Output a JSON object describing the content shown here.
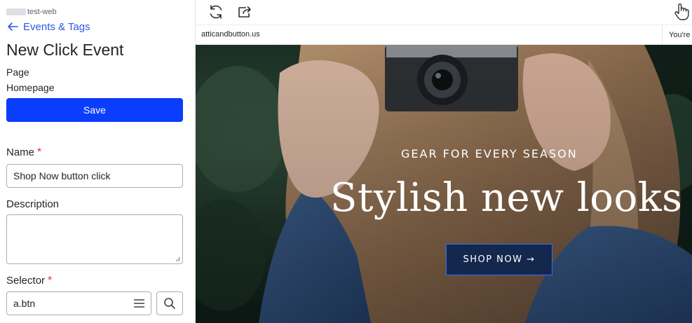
{
  "sidebar": {
    "project_name": "test-web",
    "back_link": "Events & Tags",
    "title": "New Click Event",
    "page_label": "Page",
    "page_value": "Homepage",
    "save_label": "Save",
    "name_label": "Name",
    "name_value": "Shop Now button click",
    "description_label": "Description",
    "selector_label": "Selector",
    "selector_value": "a.btn",
    "required_mark": "*"
  },
  "preview": {
    "url": "atticandbutton.us",
    "status_text": "You're",
    "hero": {
      "eyebrow": "GEAR FOR EVERY SEASON",
      "headline": "Stylish new looks",
      "cta": "SHOP NOW →"
    }
  },
  "icons": {
    "back": "arrow-left-icon",
    "refresh": "refresh-icon",
    "open_external": "open-external-icon",
    "pointer": "hand-pointer-icon",
    "menu": "hamburger-menu-icon",
    "search": "search-icon"
  },
  "colors": {
    "primary": "#0b3dfd",
    "link": "#2f57e6",
    "required": "#e0322d",
    "cta_bg": "#14284e",
    "cta_border": "#3a6cf0"
  }
}
